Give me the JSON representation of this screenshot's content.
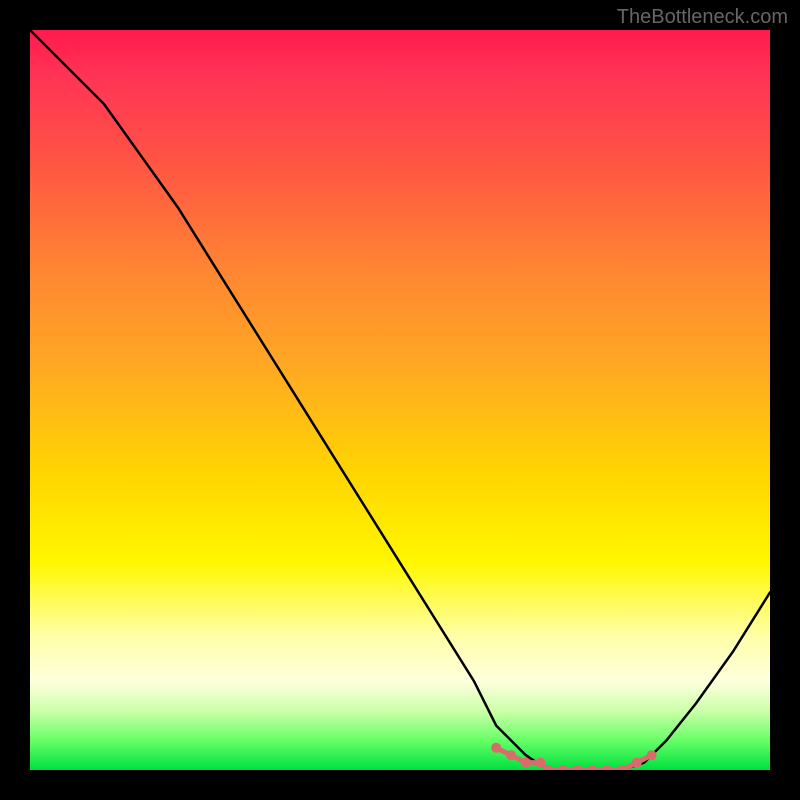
{
  "watermark": "TheBottleneck.com",
  "chart_data": {
    "type": "line",
    "title": "",
    "xlabel": "",
    "ylabel": "",
    "xlim": [
      0,
      100
    ],
    "ylim": [
      0,
      100
    ],
    "series": [
      {
        "name": "bottleneck-curve",
        "x": [
          0,
          5,
          10,
          15,
          20,
          25,
          30,
          35,
          40,
          45,
          50,
          55,
          60,
          63,
          67,
          70,
          73,
          76,
          80,
          83,
          86,
          90,
          95,
          100
        ],
        "y": [
          100,
          95,
          90,
          83,
          76,
          68,
          60,
          52,
          44,
          36,
          28,
          20,
          12,
          6,
          2,
          0,
          0,
          0,
          0,
          1,
          4,
          9,
          16,
          24
        ]
      }
    ],
    "markers": {
      "name": "optimal-range",
      "x": [
        63,
        65,
        67,
        69,
        70,
        72,
        74,
        76,
        78,
        80,
        82,
        84
      ],
      "y": [
        3,
        2,
        1,
        1,
        0,
        0,
        0,
        0,
        0,
        0,
        1,
        2
      ]
    },
    "gradient_stops": [
      {
        "pos": 0,
        "color": "#ff1a4d"
      },
      {
        "pos": 18,
        "color": "#ff5544"
      },
      {
        "pos": 46,
        "color": "#ffaa22"
      },
      {
        "pos": 72,
        "color": "#fff700"
      },
      {
        "pos": 92,
        "color": "#ccffaa"
      },
      {
        "pos": 100,
        "color": "#00e040"
      }
    ]
  }
}
